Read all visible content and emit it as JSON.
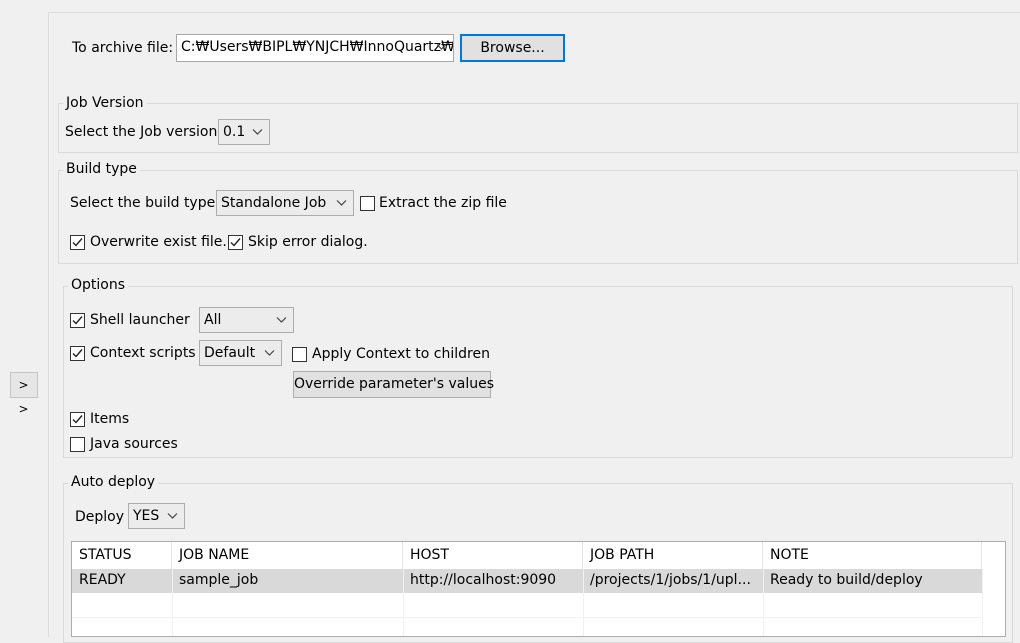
{
  "expand_button": {
    "label": "> >"
  },
  "archive": {
    "label": "To archive file:",
    "value": "C:₩Users₩BIPL₩YNJCH₩InnoQuartz₩",
    "browse_label": "Browse..."
  },
  "job_version": {
    "title": "Job Version",
    "select_label": "Select the Job version",
    "selected": "0.1"
  },
  "build_type": {
    "title": "Build type",
    "select_label": "Select the build type",
    "selected": "Standalone Job",
    "extract_zip": {
      "label": "Extract the zip file",
      "checked": false
    },
    "overwrite": {
      "label": "Overwrite exist file.",
      "checked": true
    },
    "skip_error": {
      "label": "Skip error dialog.",
      "checked": true
    }
  },
  "options": {
    "title": "Options",
    "shell_launcher": {
      "label": "Shell launcher",
      "checked": true,
      "selected": "All"
    },
    "context_scripts": {
      "label": "Context scripts",
      "checked": true,
      "selected": "Default"
    },
    "apply_context": {
      "label": "Apply Context to children",
      "checked": false
    },
    "override_label": "Override parameter's values",
    "items": {
      "label": "Items",
      "checked": true
    },
    "java_sources": {
      "label": "Java sources",
      "checked": false
    }
  },
  "auto_deploy": {
    "title": "Auto deploy",
    "deploy_label": "Deploy",
    "deploy_selected": "YES",
    "columns": [
      "STATUS",
      "JOB NAME",
      "HOST",
      "JOB PATH",
      "NOTE"
    ],
    "rows": [
      [
        "READY",
        "sample_job",
        "http://localhost:9090",
        "/projects/1/jobs/1/upl...",
        "Ready to build/deploy"
      ]
    ]
  }
}
